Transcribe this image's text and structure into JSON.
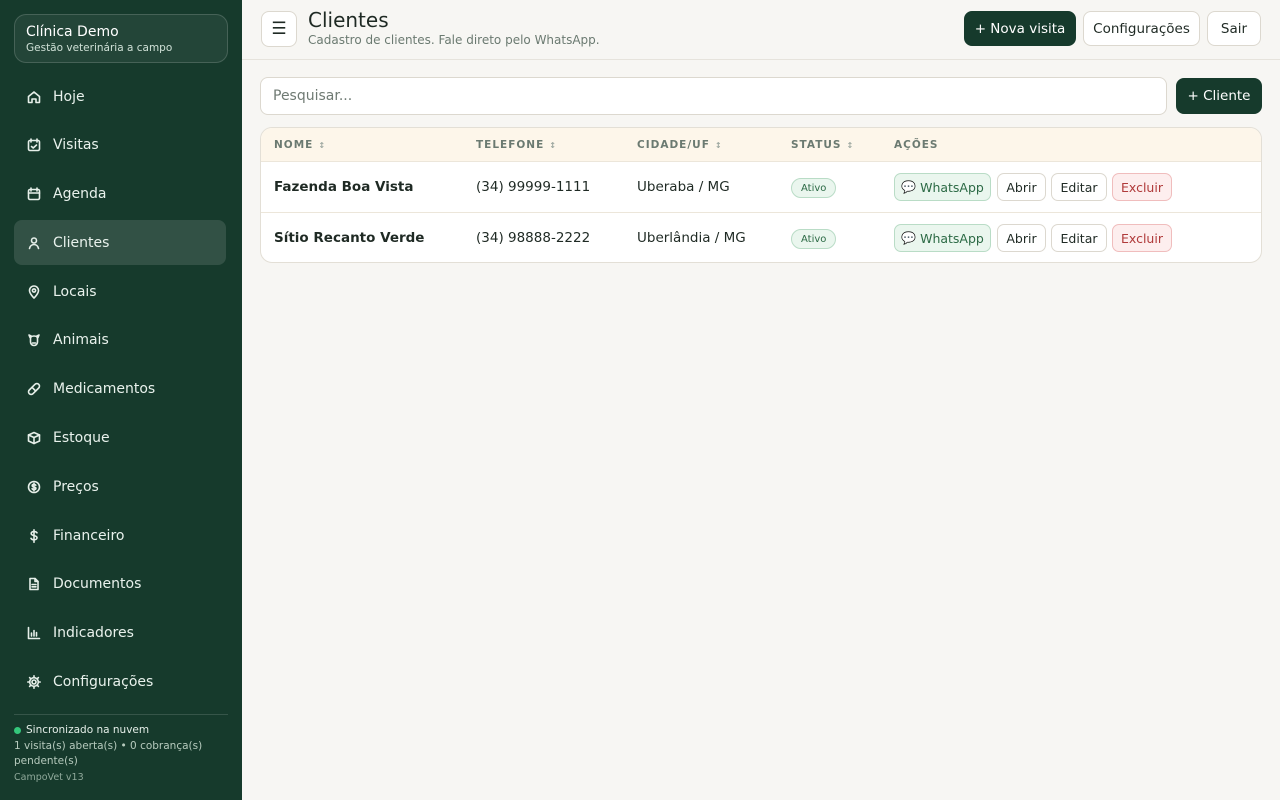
{
  "sidebar": {
    "brand_title": "Clínica Demo",
    "brand_subtitle": "Gestão veterinária a campo",
    "items": [
      {
        "label": "Hoje",
        "icon": "home-icon",
        "active": false
      },
      {
        "label": "Visitas",
        "icon": "calendar-check-icon",
        "active": false
      },
      {
        "label": "Agenda",
        "icon": "calendar-icon",
        "active": false
      },
      {
        "label": "Clientes",
        "icon": "user-icon",
        "active": true
      },
      {
        "label": "Locais",
        "icon": "map-pin-icon",
        "active": false
      },
      {
        "label": "Animais",
        "icon": "animal-icon",
        "active": false
      },
      {
        "label": "Medicamentos",
        "icon": "pill-icon",
        "active": false
      },
      {
        "label": "Estoque",
        "icon": "box-icon",
        "active": false
      },
      {
        "label": "Preços",
        "icon": "tag-icon",
        "active": false
      },
      {
        "label": "Financeiro",
        "icon": "dollar-icon",
        "active": false
      },
      {
        "label": "Documentos",
        "icon": "document-icon",
        "active": false
      },
      {
        "label": "Indicadores",
        "icon": "bar-chart-icon",
        "active": false
      },
      {
        "label": "Configurações",
        "icon": "gear-icon",
        "active": false
      }
    ],
    "footer": {
      "sync_status": "Sincronizado na nuvem",
      "pending": "1 visita(s) aberta(s) • 0 cobrança(s) pendente(s)",
      "version": "CampoVet v13"
    }
  },
  "header": {
    "menu_icon": "☰",
    "title": "Clientes",
    "subtitle": "Cadastro de clientes. Fale direto pelo WhatsApp.",
    "new_visit_label": "+ Nova visita",
    "settings_label": "Configurações",
    "logout_label": "Sair"
  },
  "search": {
    "placeholder": "Pesquisar...",
    "value": ""
  },
  "add_client_label": "+ Cliente",
  "table": {
    "columns": [
      "NOME",
      "TELEFONE",
      "CIDADE/UF",
      "STATUS",
      "AÇÕES"
    ],
    "sort_glyph": "↕",
    "rows": [
      {
        "name": "Fazenda Boa Vista",
        "phone": "(34) 99999-1111",
        "city": "Uberaba / MG",
        "status": "Ativo"
      },
      {
        "name": "Sítio Recanto Verde",
        "phone": "(34) 98888-2222",
        "city": "Uberlândia / MG",
        "status": "Ativo"
      }
    ],
    "actions": {
      "whatsapp_icon": "💬",
      "whatsapp": "WhatsApp",
      "open": "Abrir",
      "edit": "Editar",
      "delete": "Excluir"
    }
  },
  "colors": {
    "sidebar_bg": "#163a2c",
    "primary": "#163a2c",
    "success": "#2c6a45",
    "danger": "#b03a3a",
    "table_header_bg": "#fdf6ea"
  }
}
